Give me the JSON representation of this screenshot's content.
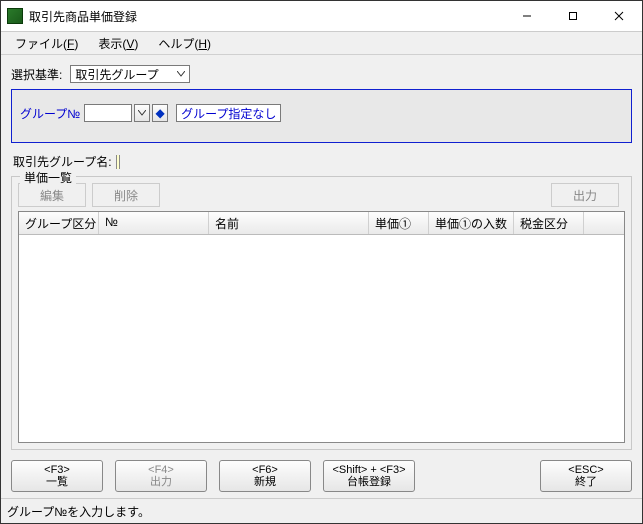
{
  "window": {
    "title": "取引先商品単価登録"
  },
  "menu": {
    "file": "ファイル(",
    "file_mn": "F",
    "file_close": ")",
    "view": "表示(",
    "view_mn": "V",
    "view_close": ")",
    "help": "ヘルプ(",
    "help_mn": "H",
    "help_close": ")"
  },
  "criteria": {
    "label": "選択基準:",
    "value": "取引先グループ"
  },
  "group": {
    "label": "グループ№",
    "input_value": "",
    "no_spec": "グループ指定なし"
  },
  "group_name": {
    "label": "取引先グループ名:"
  },
  "list": {
    "title": "単価一覧",
    "edit": "編集",
    "delete": "削除",
    "export": "出力",
    "columns": {
      "c1": "グループ区分",
      "c2": "№",
      "c3": "名前",
      "c4": "単価①",
      "c5": "単価①の入数",
      "c6": "税金区分",
      "c7": ""
    }
  },
  "fkeys": {
    "f3_key": "<F3>",
    "f3_label": "一覧",
    "f4_key": "<F4>",
    "f4_label": "出力",
    "f6_key": "<F6>",
    "f6_label": "新規",
    "sf3_key": "<Shift> + <F3>",
    "sf3_label": "台帳登録",
    "esc_key": "<ESC>",
    "esc_label": "終了"
  },
  "status": {
    "text": "グループ№を入力します。"
  }
}
